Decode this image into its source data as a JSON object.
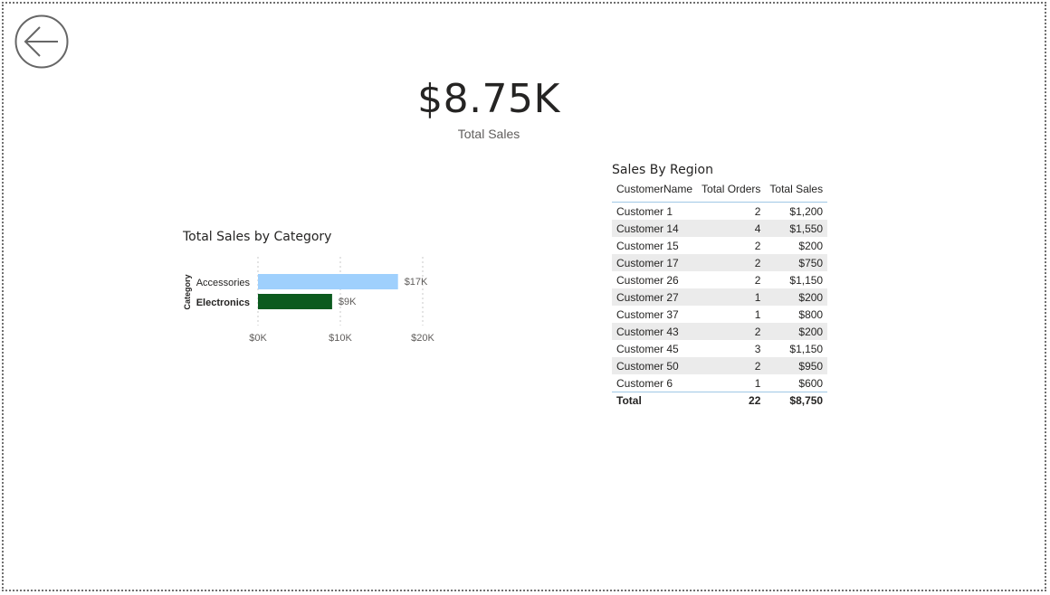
{
  "back_button": {
    "icon": "arrow-left-icon"
  },
  "kpi": {
    "value": "$8.75K",
    "label": "Total Sales"
  },
  "category_chart": {
    "title": "Total Sales by Category",
    "axis_title": "Category",
    "tick_labels": [
      "$0K",
      "$10K",
      "$20K"
    ]
  },
  "chart_data": {
    "type": "bar",
    "orientation": "horizontal",
    "title": "Total Sales by Category",
    "ylabel": "Category",
    "xlabel": "",
    "categories": [
      "Accessories",
      "Electronics"
    ],
    "values": [
      17,
      9
    ],
    "data_labels": [
      "$17K",
      "$9K"
    ],
    "value_unit": "$K",
    "xlim": [
      0,
      20
    ],
    "xticks": [
      0,
      10,
      20
    ],
    "tick_labels": [
      "$0K",
      "$10K",
      "$20K"
    ],
    "grid": true,
    "colors": [
      "#9fd0fd",
      "#0b5a1e"
    ],
    "highlighted_category": "Electronics"
  },
  "region_table": {
    "title": "Sales By Region",
    "columns": [
      "CustomerName",
      "Total Orders",
      "Total Sales"
    ],
    "rows": [
      [
        "Customer 1",
        "2",
        "$1,200"
      ],
      [
        "Customer 14",
        "4",
        "$1,550"
      ],
      [
        "Customer 15",
        "2",
        "$200"
      ],
      [
        "Customer 17",
        "2",
        "$750"
      ],
      [
        "Customer 26",
        "2",
        "$1,150"
      ],
      [
        "Customer 27",
        "1",
        "$200"
      ],
      [
        "Customer 37",
        "1",
        "$800"
      ],
      [
        "Customer 43",
        "2",
        "$200"
      ],
      [
        "Customer 45",
        "3",
        "$1,150"
      ],
      [
        "Customer 50",
        "2",
        "$950"
      ],
      [
        "Customer 6",
        "1",
        "$600"
      ]
    ],
    "total": [
      "Total",
      "22",
      "$8,750"
    ]
  },
  "colors": {
    "accent_header_line": "#a0c8e6",
    "row_band": "#ebebeb",
    "text": "#252423",
    "muted": "#605e5c"
  }
}
